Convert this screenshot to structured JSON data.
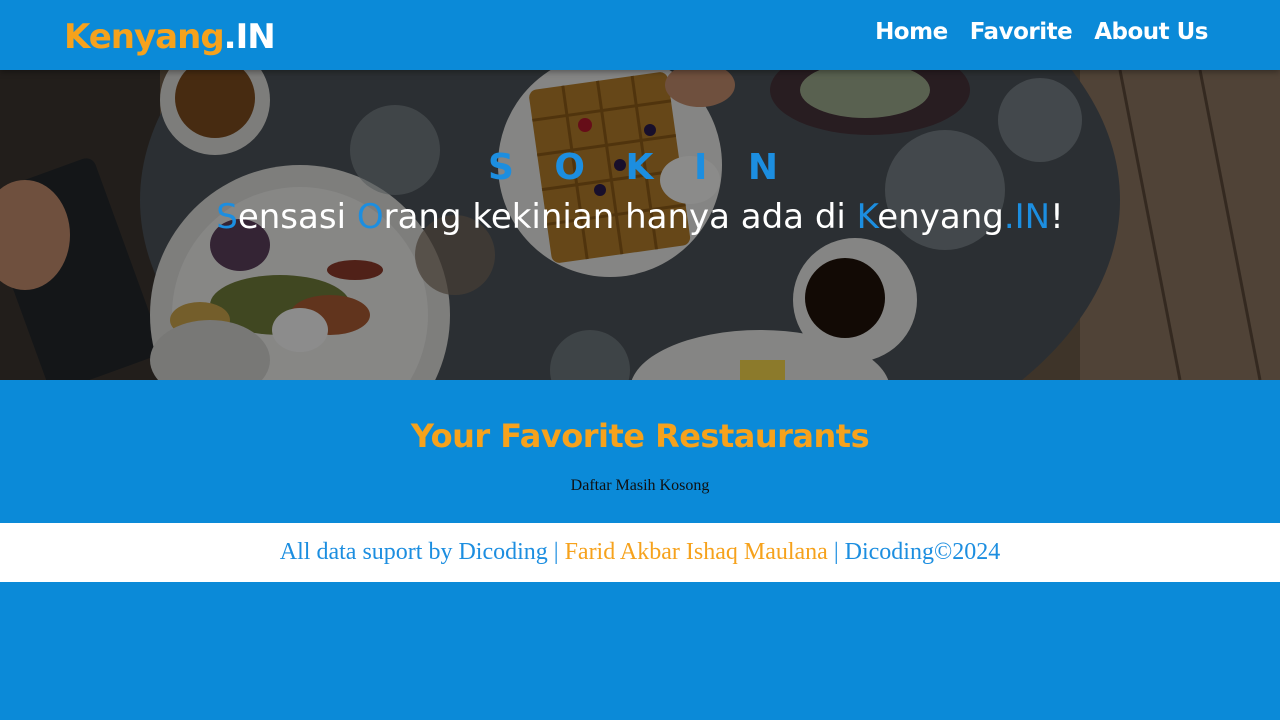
{
  "header": {
    "brand_primary": "Kenyang",
    "brand_secondary": ".IN",
    "nav": [
      {
        "label": "Home"
      },
      {
        "label": "Favorite"
      },
      {
        "label": "About Us"
      }
    ]
  },
  "hero": {
    "title": "S O K I N",
    "tagline": [
      {
        "text": "S",
        "highlight": true
      },
      {
        "text": "ensasi ",
        "highlight": false
      },
      {
        "text": "O",
        "highlight": true
      },
      {
        "text": "rang kekinian hanya ada di ",
        "highlight": false
      },
      {
        "text": "K",
        "highlight": true
      },
      {
        "text": "enyang",
        "highlight": false
      },
      {
        "text": ".IN",
        "highlight": true
      },
      {
        "text": "!",
        "highlight": false
      }
    ]
  },
  "main": {
    "title": "Your Favorite Restaurants",
    "empty_message": "Daftar Masih Kosong"
  },
  "footer": {
    "part1": "All data suport by Dicoding | ",
    "author": "Farid Akbar Ishaq Maulana",
    "part2": " | Dicoding©2024"
  },
  "colors": {
    "primary": "#0b8ad8",
    "accent": "#f6a21c",
    "highlight": "#1c8ee0",
    "footer_bg": "#ffffff"
  }
}
